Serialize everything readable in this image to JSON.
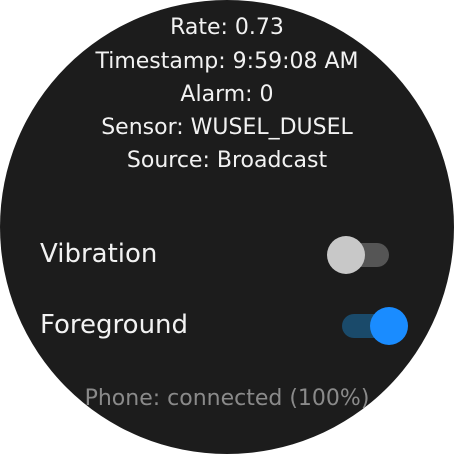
{
  "info": {
    "rate": "Rate: 0.73",
    "timestamp": "Timestamp: 9:59:08 AM",
    "alarm": "Alarm: 0",
    "sensor": "Sensor: WUSEL_DUSEL",
    "source": "Source: Broadcast"
  },
  "settings": {
    "vibration": {
      "label": "Vibration",
      "enabled": false
    },
    "foreground": {
      "label": "Foreground",
      "enabled": true
    }
  },
  "status": {
    "phone": "Phone: connected (100%)"
  },
  "colors": {
    "background": "#1c1c1c",
    "accent": "#1a8cff",
    "text": "#f2f2f2",
    "muted_text": "#8a8a8a"
  }
}
